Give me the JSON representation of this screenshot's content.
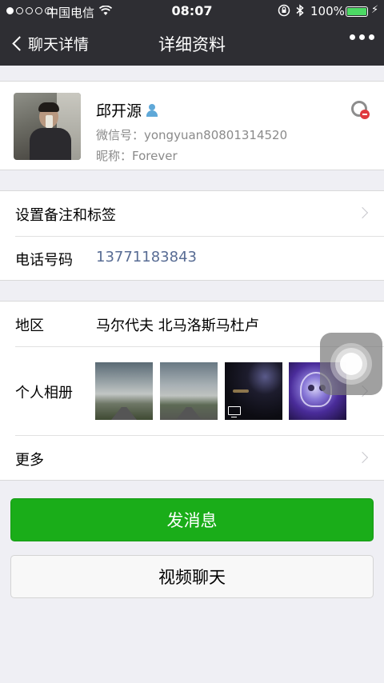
{
  "status_bar": {
    "carrier": "中国电信",
    "time": "08:07",
    "battery_percent": "100%",
    "battery_color": "#4cd964"
  },
  "nav": {
    "back_label": "聊天详情",
    "title": "详细资料",
    "more_icon": "more-dots-icon"
  },
  "profile": {
    "name": "邱开源",
    "wechat_id": "微信号：yongyuan80801314520",
    "nickname": "昵称：Forever"
  },
  "rows": {
    "remark": {
      "label": "设置备注和标签"
    },
    "phone": {
      "label": "电话号码",
      "value": "13771183843"
    },
    "region": {
      "label": "地区",
      "value": "马尔代夫 北马洛斯马杜卢"
    },
    "album": {
      "label": "个人相册"
    },
    "more": {
      "label": "更多"
    }
  },
  "buttons": {
    "send_message": "发消息",
    "video_chat": "视频聊天"
  },
  "colors": {
    "nav_bg": "#2e2e33",
    "primary_button": "#1aad19",
    "link_text": "#586c94",
    "page_bg": "#efeff4"
  }
}
